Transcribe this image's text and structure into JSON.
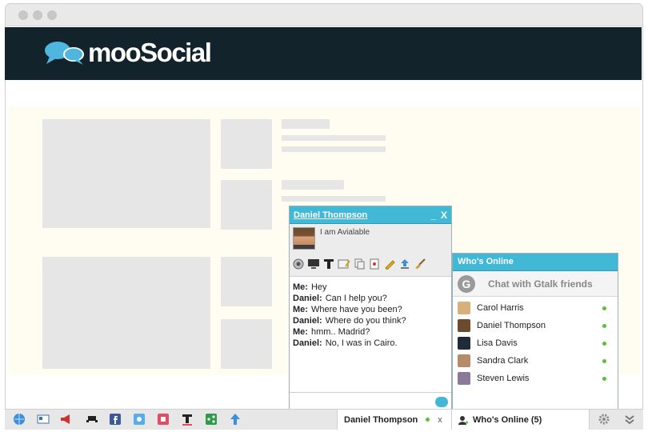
{
  "logo": {
    "text": "mooSocial"
  },
  "chat": {
    "title": "Daniel Thompson",
    "minimize": "_",
    "close": "X",
    "status": "I am Avialable",
    "toolbar_icons": [
      "webcam-icon",
      "screen-share-icon",
      "text-format-icon",
      "whiteboard-icon",
      "file-transfer-icon",
      "card-icon",
      "pencil-icon",
      "upload-icon",
      "broom-icon"
    ],
    "messages": [
      {
        "sender": "Me:",
        "text": "Hey"
      },
      {
        "sender": "Daniel:",
        "text": "Can I help you?"
      },
      {
        "sender": "Me:",
        "text": "Where have you been?"
      },
      {
        "sender": "Daniel:",
        "text": "Where do you think?"
      },
      {
        "sender": "Me:",
        "text": "hmm.. Madrid?"
      },
      {
        "sender": "Daniel:",
        "text": "No, I was in Cairo."
      }
    ]
  },
  "online": {
    "title": "Who's Online",
    "gtalk_icon": "G",
    "gtalk_label": "Chat with Gtalk friends",
    "friends": [
      {
        "name": "Carol Harris",
        "color": "#d8b07a"
      },
      {
        "name": "Daniel Thompson",
        "color": "#6b4a2e"
      },
      {
        "name": "Lisa Davis",
        "color": "#1f2a3a"
      },
      {
        "name": "Sandra Clark",
        "color": "#b78a6a"
      },
      {
        "name": "Steven Lewis",
        "color": "#8a7a9a"
      }
    ]
  },
  "bottom_bar": {
    "chat_tab_name": "Daniel Thompson",
    "chat_tab_close": "x",
    "online_tab_label": "Who's Online (5)"
  }
}
